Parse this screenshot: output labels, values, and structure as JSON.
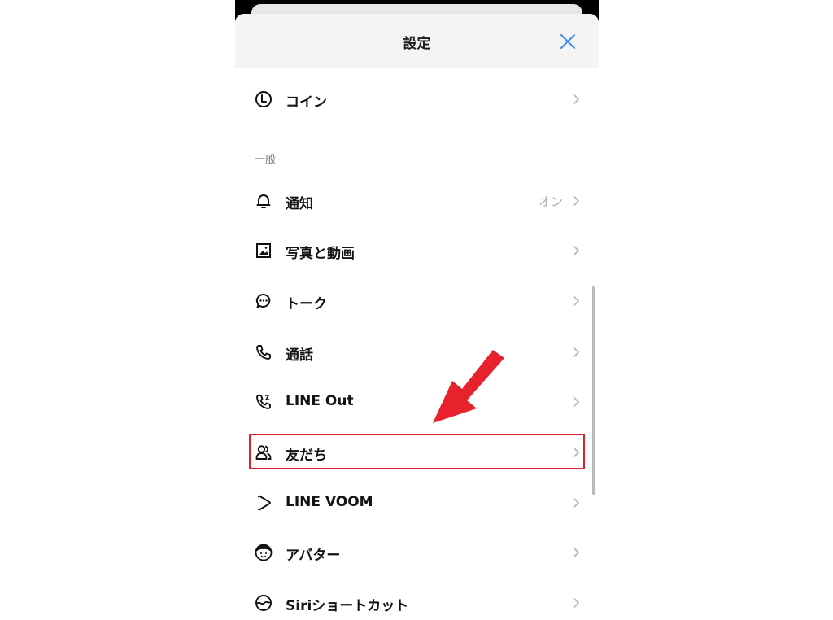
{
  "header": {
    "title": "設定"
  },
  "sections": {
    "general_label": "一般"
  },
  "rows": [
    {
      "label": "コイン",
      "value": ""
    },
    {
      "label": "通知",
      "value": "オン"
    },
    {
      "label": "写真と動画",
      "value": ""
    },
    {
      "label": "トーク",
      "value": ""
    },
    {
      "label": "通話",
      "value": ""
    },
    {
      "label": "LINE Out",
      "value": ""
    },
    {
      "label": "友だち",
      "value": ""
    },
    {
      "label": "LINE VOOM",
      "value": ""
    },
    {
      "label": "アバター",
      "value": ""
    },
    {
      "label": "Siriショートカット",
      "value": ""
    }
  ],
  "colors": {
    "accent_close": "#3c8cf0",
    "highlight": "#e0202a",
    "arrow": "#e8222c"
  },
  "icons": {
    "close": "close-icon",
    "chevron": "chevron-right-icon"
  }
}
